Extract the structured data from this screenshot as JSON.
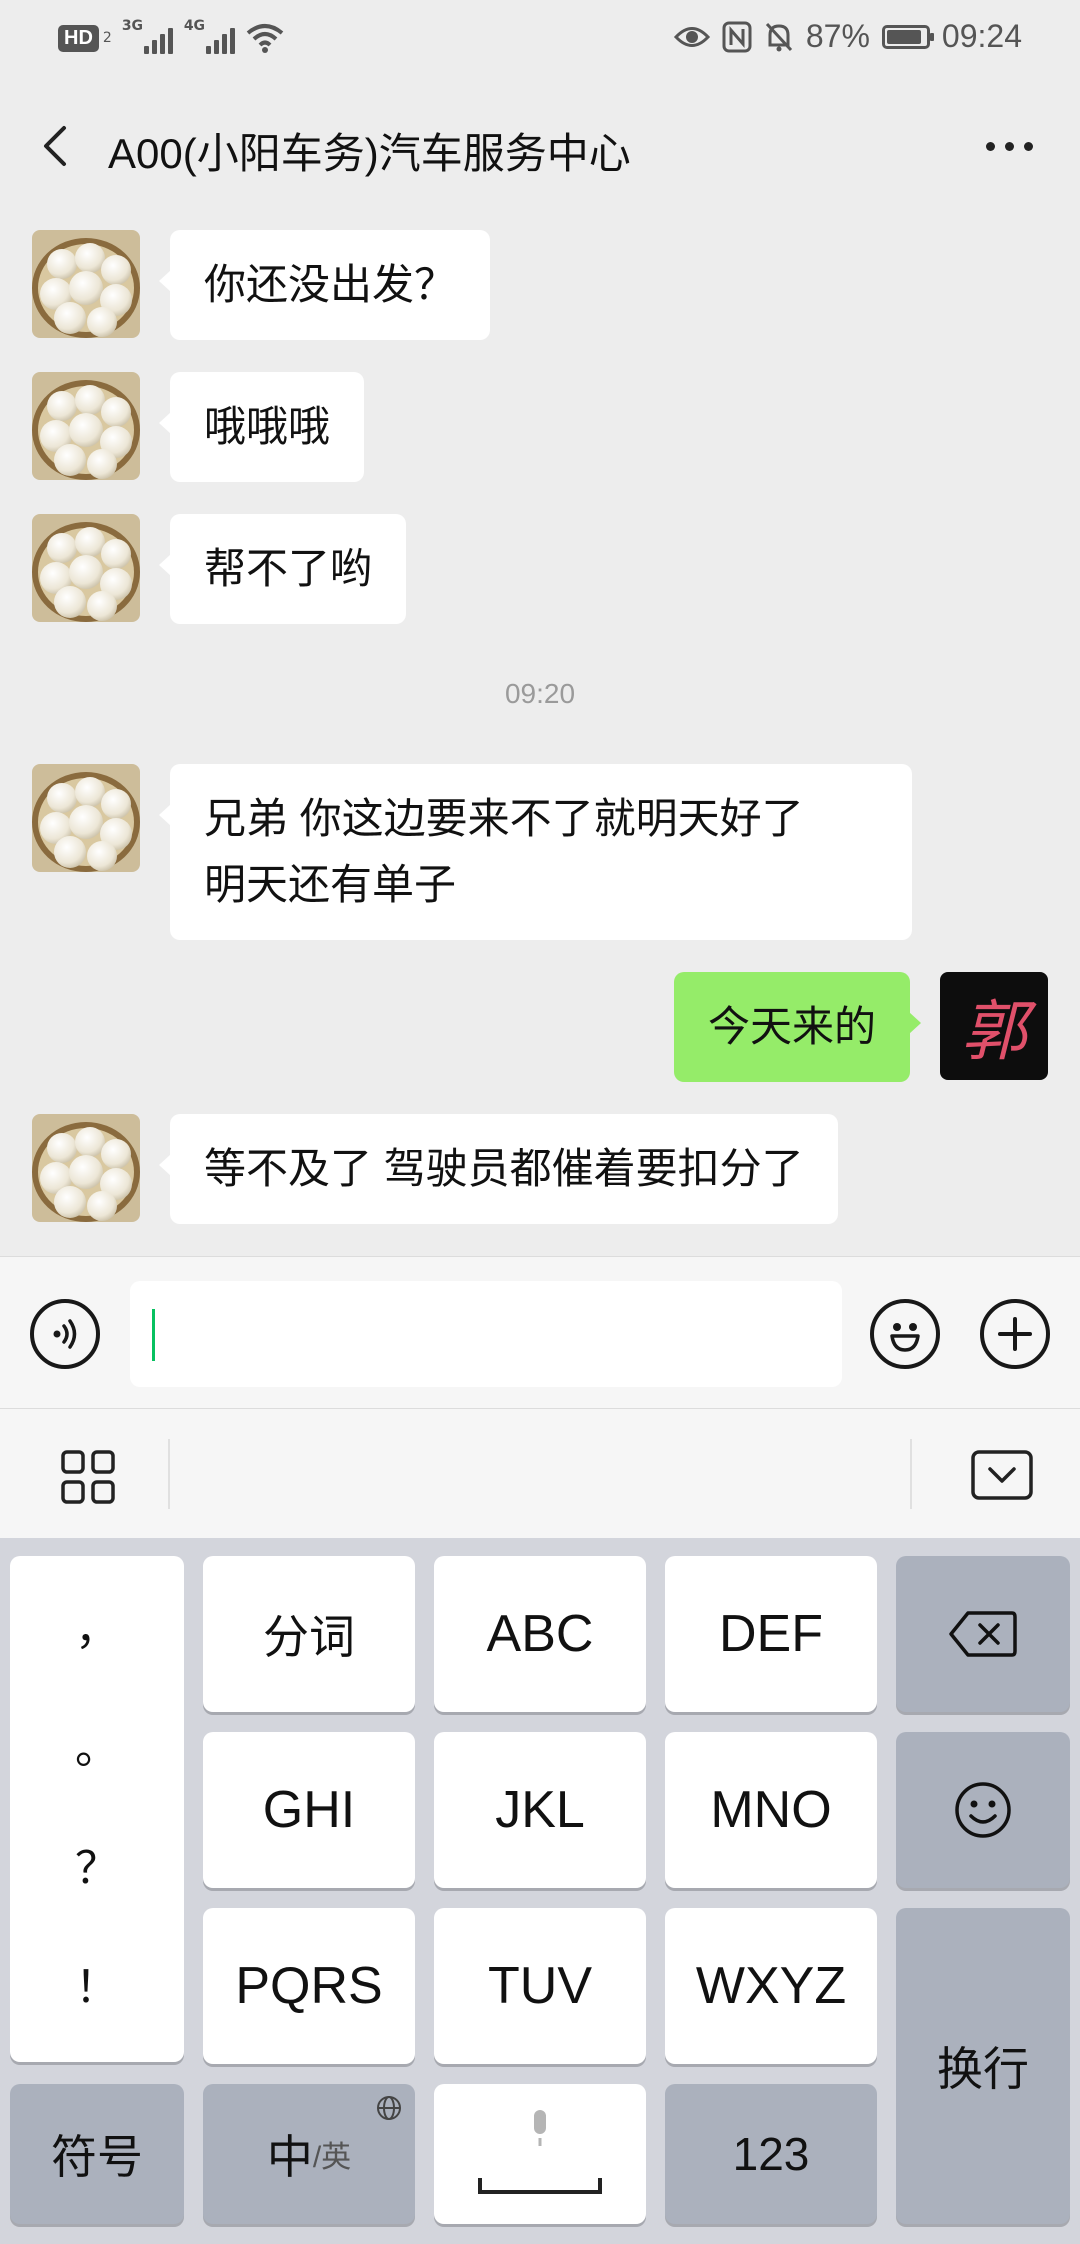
{
  "status_bar": {
    "hd": "HD",
    "hd_sub": "2",
    "signal1_tag": "3G",
    "signal2_tag": "4G",
    "battery": "87%",
    "time": "09:24"
  },
  "header": {
    "title": "A00(小阳车务)汽车服务中心"
  },
  "messages": [
    {
      "side": "left",
      "text": "你还没出发？"
    },
    {
      "side": "left",
      "text": "哦哦哦"
    },
    {
      "side": "left",
      "text": "帮不了哟"
    },
    {
      "type": "time",
      "text": "09:20"
    },
    {
      "side": "left",
      "line1": "兄弟 你这边要来不了就明天好了",
      "line2": "明天还有单子"
    },
    {
      "side": "right",
      "text": "今天来的",
      "avatar_char": "郭"
    },
    {
      "side": "left",
      "text": "等不及了 驾驶员都催着要扣分了"
    }
  ],
  "input": {
    "value": "",
    "placeholder": ""
  },
  "keyboard": {
    "punct": [
      "，",
      "。",
      "？",
      "！"
    ],
    "row1": [
      "分词",
      "ABC",
      "DEF"
    ],
    "row2": [
      "GHI",
      "JKL",
      "MNO"
    ],
    "row3": [
      "PQRS",
      "TUV",
      "WXYZ"
    ],
    "enter": "换行",
    "symbols": "符号",
    "lang_main": "中",
    "lang_sub": "/英",
    "num": "123"
  },
  "colors": {
    "accent_green": "#95ec69",
    "caret_green": "#07c160",
    "background": "#ededed"
  }
}
